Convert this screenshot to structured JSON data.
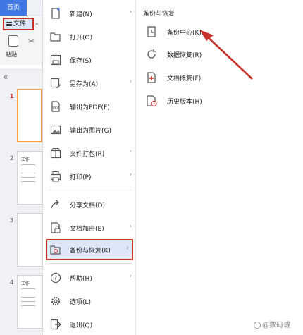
{
  "app": {
    "home_tab": "首页",
    "file_button": "文件",
    "paste_label": "粘贴",
    "slides": [
      {
        "number": "1",
        "active": true,
        "title": ""
      },
      {
        "number": "2",
        "active": false,
        "title": "工作"
      },
      {
        "number": "3",
        "active": false,
        "title": ""
      },
      {
        "number": "4",
        "active": false,
        "title": "工作"
      }
    ]
  },
  "menu": {
    "items": [
      {
        "label": "新建(N)",
        "icon": "new-doc-icon",
        "submenu": true
      },
      {
        "label": "打开(O)",
        "icon": "open-folder-icon",
        "submenu": false
      },
      {
        "label": "保存(S)",
        "icon": "save-icon",
        "submenu": false
      },
      {
        "label": "另存为(A)",
        "icon": "save-as-icon",
        "submenu": true
      },
      {
        "label": "输出为PDF(F)",
        "icon": "pdf-icon",
        "submenu": false
      },
      {
        "label": "输出为图片(G)",
        "icon": "image-icon",
        "submenu": false
      },
      {
        "label": "文件打包(R)",
        "icon": "package-icon",
        "submenu": true
      },
      {
        "label": "打印(P)",
        "icon": "print-icon",
        "submenu": true
      },
      {
        "label": "分享文档(D)",
        "icon": "share-icon",
        "submenu": false
      },
      {
        "label": "文档加密(E)",
        "icon": "encrypt-icon",
        "submenu": true
      },
      {
        "label": "备份与恢复(K)",
        "icon": "backup-restore-icon",
        "submenu": true,
        "selected": true
      },
      {
        "label": "帮助(H)",
        "icon": "help-icon",
        "submenu": true
      },
      {
        "label": "选项(L)",
        "icon": "gear-icon",
        "submenu": false
      },
      {
        "label": "退出(Q)",
        "icon": "exit-icon",
        "submenu": false
      }
    ]
  },
  "submenu": {
    "title": "备份与恢复",
    "items": [
      {
        "label": "备份中心(K)",
        "icon": "backup-center-icon"
      },
      {
        "label": "数据恢复(R)",
        "icon": "data-recovery-icon"
      },
      {
        "label": "文档修复(F)",
        "icon": "doc-repair-icon"
      },
      {
        "label": "历史版本(H)",
        "icon": "history-icon"
      }
    ]
  },
  "watermark": "@数码诚",
  "colors": {
    "accent_blue": "#3f78e4",
    "highlight_red": "#c8312a",
    "selected_bg": "#dde7f8"
  }
}
